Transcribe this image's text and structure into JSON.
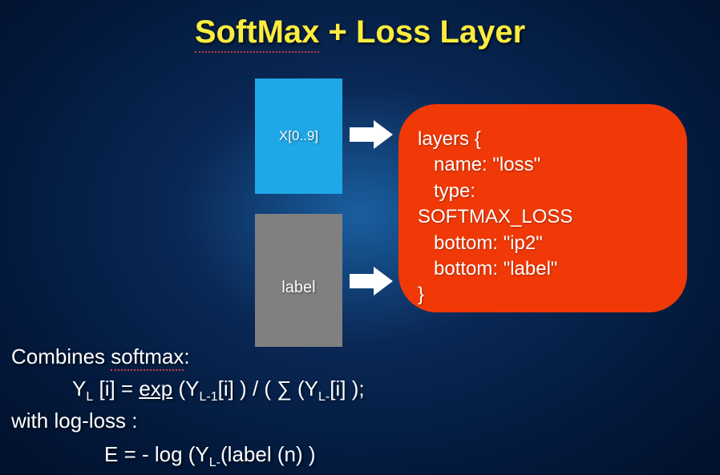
{
  "title": {
    "part1": "SoftMax",
    "part2": " + Loss Layer"
  },
  "box_x_label": "X[0..9]",
  "box_label_label": "label",
  "code": {
    "l1": "layers {",
    "l2": "name: \"loss\"",
    "l3": "type:",
    "l4": "SOFTMAX_LOSS",
    "l5": "bottom: \"ip2\"",
    "l6": "bottom: \"label\"",
    "l7": "}"
  },
  "combines_prefix": "Combines ",
  "combines_word": "softmax",
  "combines_suffix": ":",
  "formula1": {
    "y": "Y",
    "sub1": "L",
    "bracket": " [i] = ",
    "exp": "exp",
    "rest1": " (Y",
    "sub2": "L-1",
    "rest2": "[i] ) / ( ∑ (Y",
    "sub3": "L-",
    "rest3": "[i] );"
  },
  "with_log_loss": "with log-loss :",
  "formula2": {
    "e": "E = - log (Y",
    "sub": "L-",
    "rest": "(label (n) )"
  }
}
